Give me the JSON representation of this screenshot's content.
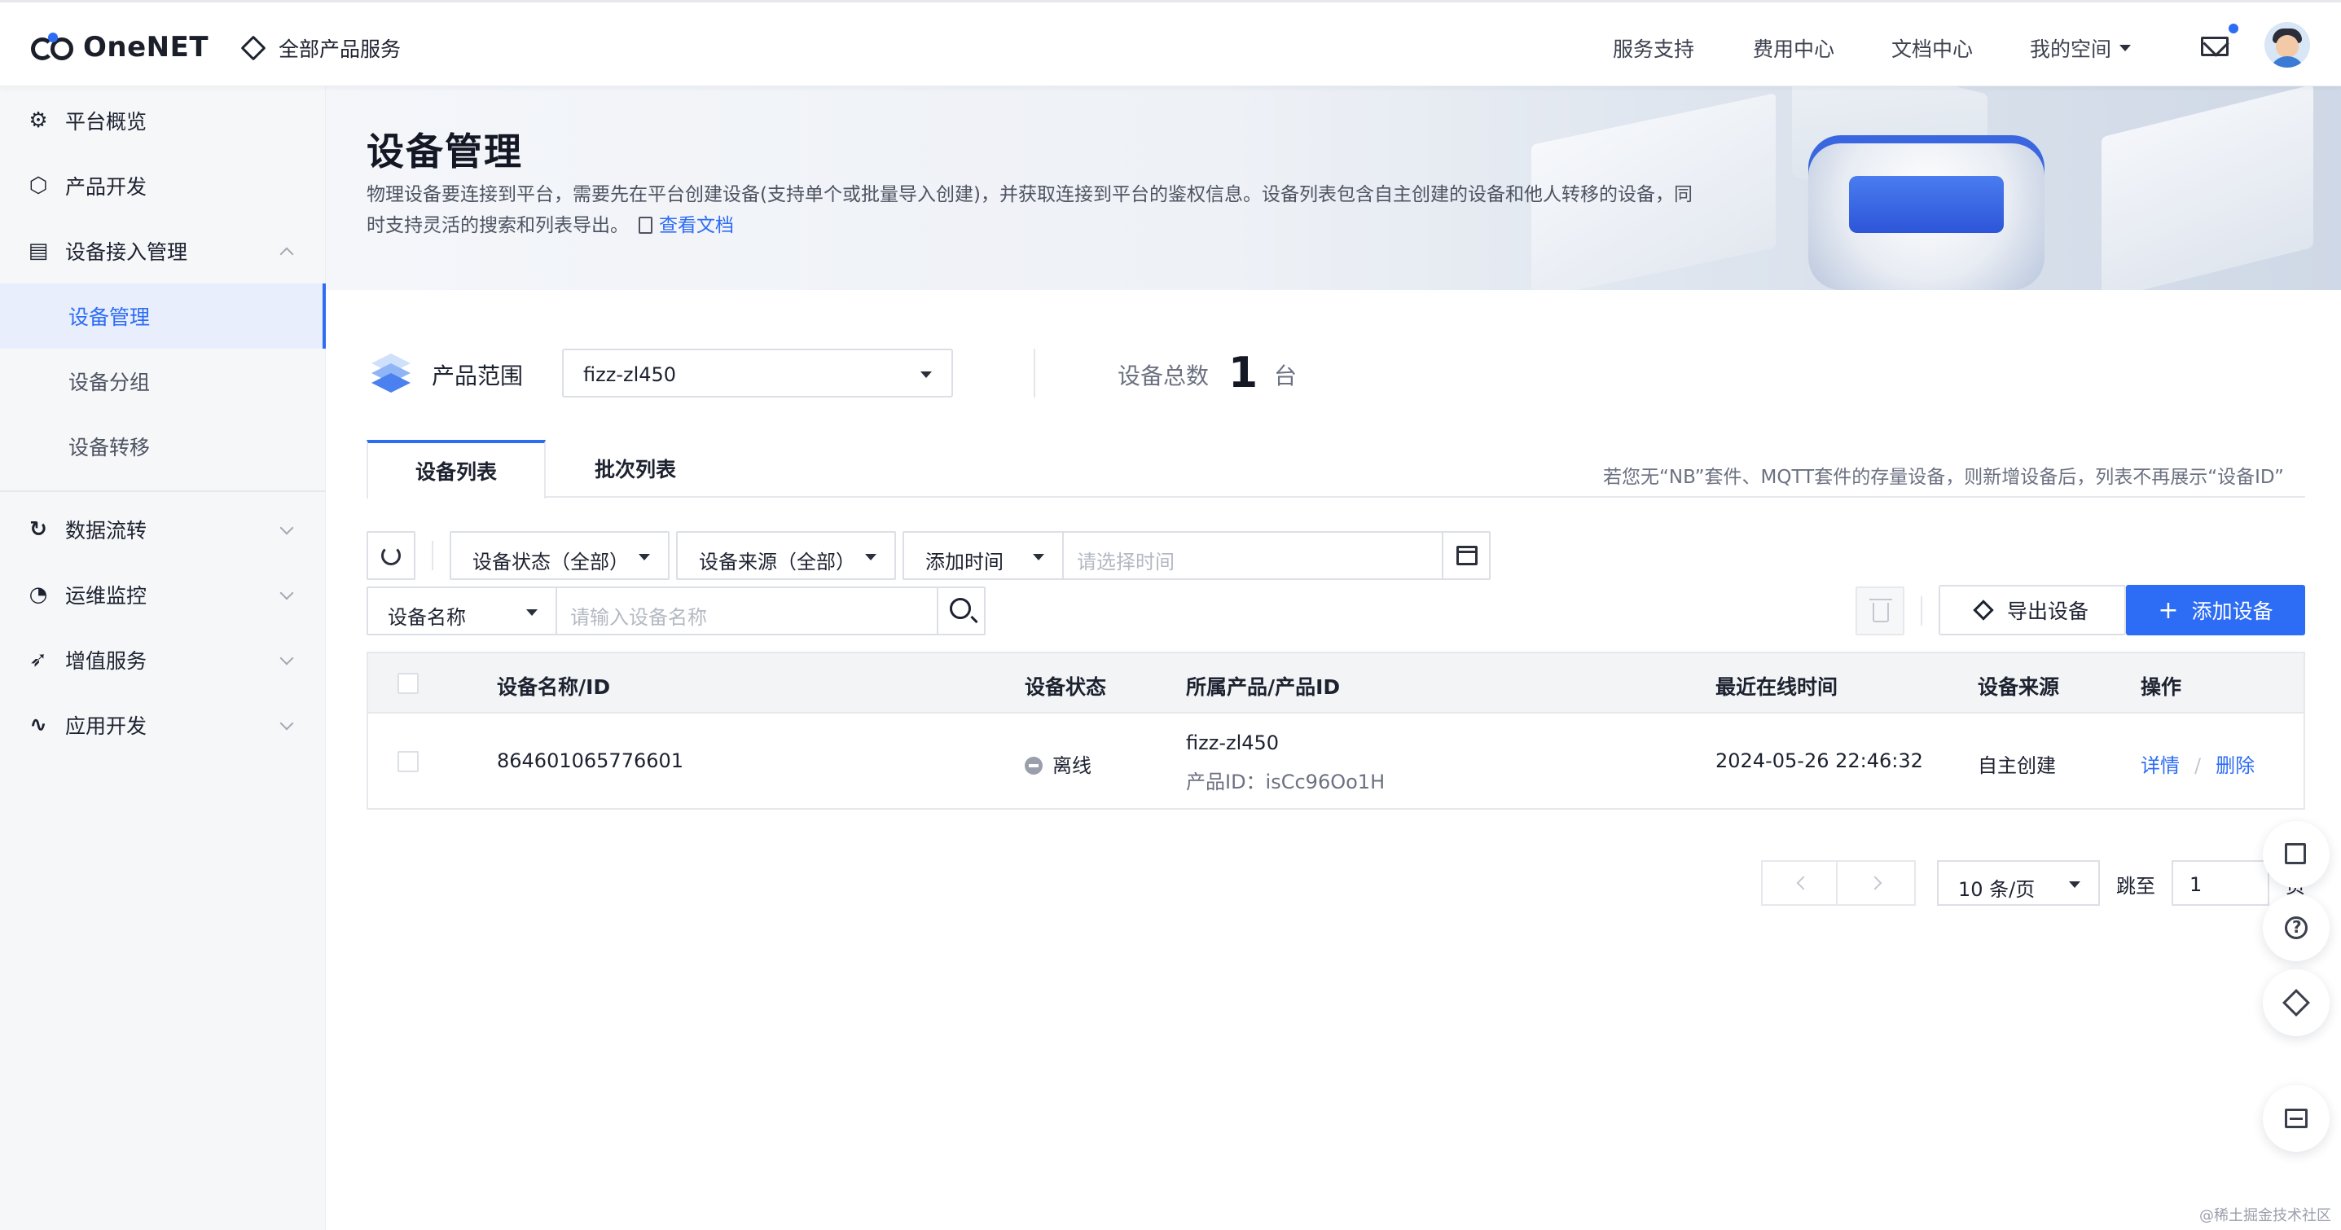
{
  "header": {
    "logo": "OneNET",
    "all_products": "全部产品服务",
    "nav": [
      "服务支持",
      "费用中心",
      "文档中心"
    ],
    "my_space": "我的空间"
  },
  "sidebar": {
    "items": [
      {
        "label": "平台概览",
        "icon": "gear-icon"
      },
      {
        "label": "产品开发",
        "icon": "cube-icon"
      },
      {
        "label": "设备接入管理",
        "icon": "device-icon"
      }
    ],
    "sub_items": [
      {
        "label": "设备管理",
        "active": true
      },
      {
        "label": "设备分组",
        "active": false
      },
      {
        "label": "设备转移",
        "active": false
      }
    ],
    "groups": [
      {
        "label": "数据流转",
        "icon": "flow-icon"
      },
      {
        "label": "运维监控",
        "icon": "monitor-icon"
      },
      {
        "label": "增值服务",
        "icon": "send-icon"
      },
      {
        "label": "应用开发",
        "icon": "app-icon"
      }
    ]
  },
  "page": {
    "title": "设备管理",
    "description": "物理设备要连接到平台，需要先在平台创建设备(支持单个或批量导入创建)，并获取连接到平台的鉴权信息。设备列表包含自主创建的设备和他人转移的设备，同时支持灵活的搜索和列表导出。",
    "doc_link": "查看文档"
  },
  "product_range": {
    "label": "产品范围",
    "selected": "fizz-zl450",
    "count_label": "设备总数",
    "count": "1",
    "count_unit": "台"
  },
  "tabs": {
    "items": [
      "设备列表",
      "批次列表"
    ],
    "active": 0,
    "hint": "若您无“NB”套件、MQTT套件的存量设备，则新增设备后，列表不再展示“设备ID”"
  },
  "filters": {
    "status": "设备状态（全部）",
    "source": "设备来源（全部）",
    "time_type": "添加时间",
    "time_placeholder": "请选择时间",
    "name_type": "设备名称",
    "name_placeholder": "请输入设备名称"
  },
  "actions": {
    "export": "导出设备",
    "add": "添加设备",
    "add_symbol": "+"
  },
  "table": {
    "columns": [
      "设备名称/ID",
      "设备状态",
      "所属产品/产品ID",
      "最近在线时间",
      "设备来源",
      "操作"
    ],
    "rows": [
      {
        "name": "864601065776601",
        "status": "离线",
        "product": "fizz-zl450",
        "product_id": "产品ID：isCc96Oo1H",
        "last_online": "2024-05-26 22:46:32",
        "source": "自主创建",
        "op_detail": "详情",
        "op_delete": "删除"
      }
    ]
  },
  "pagination": {
    "page_size": "10 条/页",
    "jump_label": "跳至",
    "jump_value": "1",
    "jump_suffix": "页"
  },
  "watermark": "@稀土掘金技术社区",
  "colors": {
    "accent": "#2d6cf5",
    "status_offline": "#9aa0ab"
  }
}
